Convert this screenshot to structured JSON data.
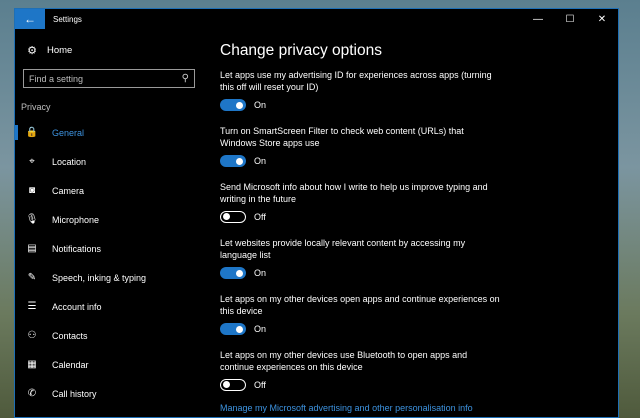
{
  "window": {
    "title": "Settings",
    "back_icon": "←",
    "minimize": "—",
    "maximize": "☐",
    "close": "✕"
  },
  "sidebar": {
    "home": {
      "label": "Home",
      "icon": "gear-icon"
    },
    "search_placeholder": "Find a setting",
    "section_label": "Privacy",
    "items": [
      {
        "label": "General",
        "icon": "lock-icon",
        "glyph": "🔒",
        "active": true
      },
      {
        "label": "Location",
        "icon": "location-icon",
        "glyph": "⌖",
        "active": false
      },
      {
        "label": "Camera",
        "icon": "camera-icon",
        "glyph": "◙",
        "active": false
      },
      {
        "label": "Microphone",
        "icon": "microphone-icon",
        "glyph": "🎙",
        "active": false
      },
      {
        "label": "Notifications",
        "icon": "notifications-icon",
        "glyph": "▤",
        "active": false
      },
      {
        "label": "Speech, inking & typing",
        "icon": "speech-icon",
        "glyph": "✎",
        "active": false
      },
      {
        "label": "Account info",
        "icon": "account-info-icon",
        "glyph": "☰",
        "active": false
      },
      {
        "label": "Contacts",
        "icon": "contacts-icon",
        "glyph": "⚇",
        "active": false
      },
      {
        "label": "Calendar",
        "icon": "calendar-icon",
        "glyph": "▦",
        "active": false
      },
      {
        "label": "Call history",
        "icon": "call-history-icon",
        "glyph": "✆",
        "active": false
      }
    ]
  },
  "main": {
    "title": "Change privacy options",
    "options": [
      {
        "text": "Let apps use my advertising ID for experiences across apps (turning this off will reset your ID)",
        "state": "On",
        "on": true
      },
      {
        "text": "Turn on SmartScreen Filter to check web content (URLs) that Windows Store apps use",
        "state": "On",
        "on": true
      },
      {
        "text": "Send Microsoft info about how I write to help us improve typing and writing in the future",
        "state": "Off",
        "on": false
      },
      {
        "text": "Let websites provide locally relevant content by accessing my language list",
        "state": "On",
        "on": true
      },
      {
        "text": "Let apps on my other devices open apps and continue experiences on this device",
        "state": "On",
        "on": true
      },
      {
        "text": "Let apps on my other devices use Bluetooth to open apps and continue experiences on this device",
        "state": "Off",
        "on": false
      }
    ],
    "manage_link": "Manage my Microsoft advertising and other personalisation info"
  },
  "colors": {
    "accent": "#1e76c7",
    "link": "#3d93e0",
    "background": "#000000"
  }
}
